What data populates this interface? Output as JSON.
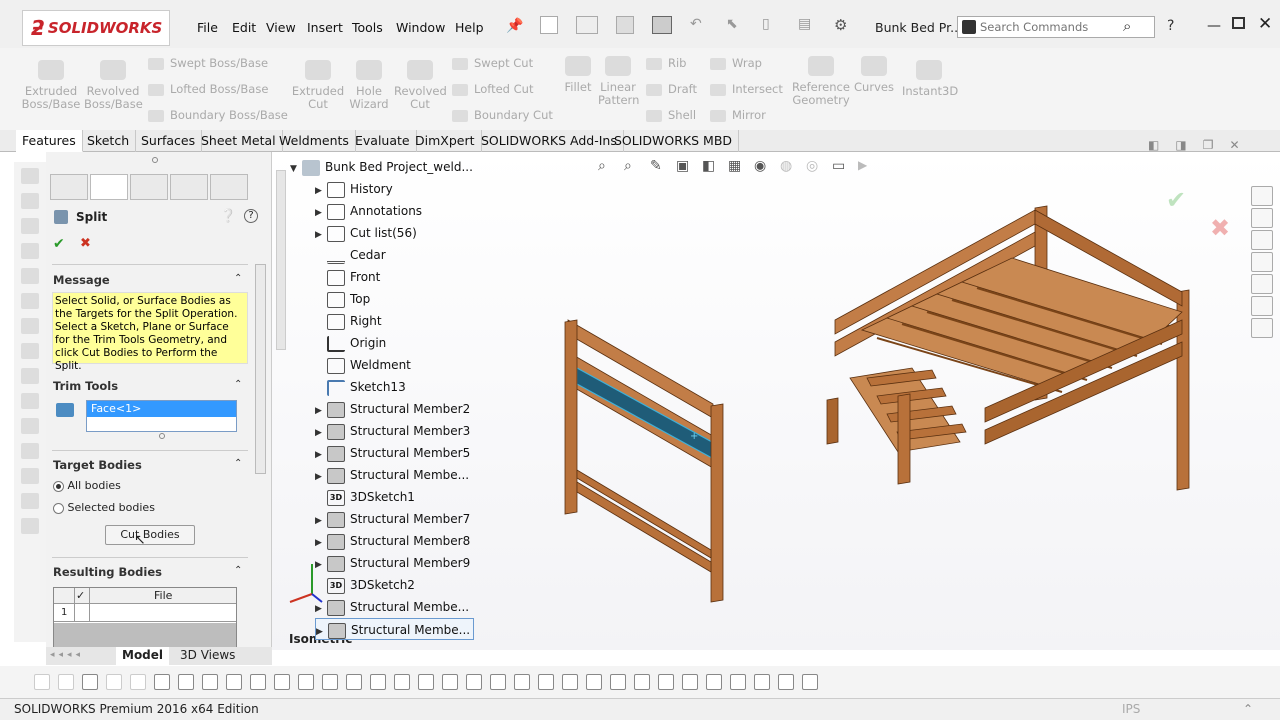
{
  "app": {
    "logo_text": "SOLIDWORKS",
    "doc_title": "Bunk Bed Pr...",
    "search_placeholder": "Search Commands"
  },
  "menu": [
    "File",
    "Edit",
    "View",
    "Insert",
    "Tools",
    "Window",
    "Help"
  ],
  "ribbon": {
    "extruded_boss": "Extruded Boss/Base",
    "revolved_boss": "Revolved Boss/Base",
    "swept_boss": "Swept Boss/Base",
    "lofted_boss": "Lofted Boss/Base",
    "boundary_boss": "Boundary Boss/Base",
    "extruded_cut": "Extruded Cut",
    "hole_wizard": "Hole Wizard",
    "revolved_cut": "Revolved Cut",
    "swept_cut": "Swept Cut",
    "lofted_cut": "Lofted Cut",
    "boundary_cut": "Boundary Cut",
    "fillet": "Fillet",
    "linear_pattern": "Linear Pattern",
    "rib": "Rib",
    "draft": "Draft",
    "shell": "Shell",
    "wrap": "Wrap",
    "intersect": "Intersect",
    "mirror": "Mirror",
    "reference_geometry": "Reference Geometry",
    "curves": "Curves",
    "instant3d": "Instant3D"
  },
  "tabs": [
    "Features",
    "Sketch",
    "Surfaces",
    "Sheet Metal",
    "Weldments",
    "Evaluate",
    "DimXpert",
    "SOLIDWORKS Add-Ins",
    "SOLIDWORKS MBD"
  ],
  "pm": {
    "title": "Split",
    "message_header": "Message",
    "message": "Select Solid, or Surface Bodies as the Targets for the Split Operation. Select a Sketch, Plane or Surface for the Trim Tools Geometry, and click Cut Bodies to Perform the Split.",
    "trim_header": "Trim Tools",
    "trim_value": "Face<1>",
    "target_header": "Target Bodies",
    "all_bodies": "All bodies",
    "selected_bodies": "Selected bodies",
    "cut_button": "Cut Bodies",
    "resulting_header": "Resulting Bodies",
    "col_file": "File",
    "row1": "1"
  },
  "tree": {
    "root": "Bunk Bed Project_weld...",
    "nodes": [
      "History",
      "Annotations",
      "Cut list(56)",
      "Cedar",
      "Front",
      "Top",
      "Right",
      "Origin",
      "Weldment",
      "Sketch13",
      "Structural Member2",
      "Structural Member3",
      "Structural Member5",
      "Structural Membe...",
      "3DSketch1",
      "Structural Member7",
      "Structural Member8",
      "Structural Member9",
      "3DSketch2",
      "Structural Membe...",
      "Structural Membe..."
    ]
  },
  "viewport": {
    "view_label": "Isometric"
  },
  "bottom_tabs": [
    "Model",
    "3D Views"
  ],
  "status": {
    "text": "SOLIDWORKS Premium 2016 x64 Edition",
    "units": "IPS"
  },
  "colors": {
    "wood": "#b8713a",
    "wood_dark": "#8a5026",
    "highlight": "#1f5c78",
    "accent": "#c8242b"
  }
}
